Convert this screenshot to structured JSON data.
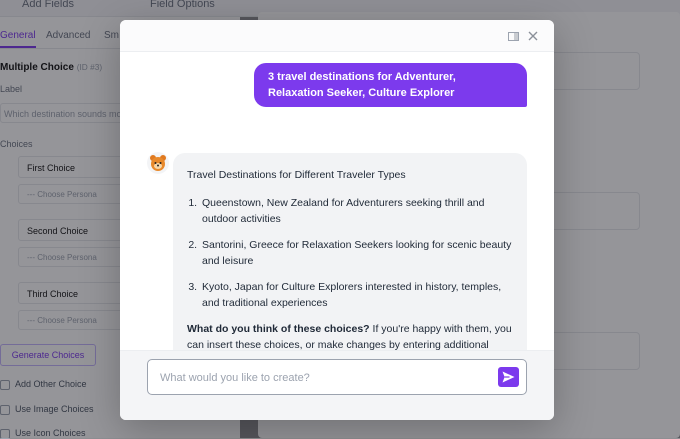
{
  "background": {
    "topbar": {
      "add_fields": "Add Fields",
      "field_options": "Field Options"
    },
    "tabs": [
      "General",
      "Advanced",
      "Sm"
    ],
    "field_title": "Multiple Choice",
    "field_id": "(ID #3)",
    "label_caption": "Label",
    "question_text": "Which destination sounds mo",
    "choices_caption": "Choices",
    "choices": [
      "First Choice",
      "Second Choice",
      "Third Choice"
    ],
    "persona_placeholder": "--- Choose Persona",
    "generate_button": "Generate Choices",
    "checkboxes": [
      "Add Other Choice",
      "Use Image Choices",
      "Use Icon Choices"
    ]
  },
  "modal": {
    "user_message": "3 travel destinations for Adventurer, Relaxation Seeker, Culture Explorer",
    "bot": {
      "heading": "Travel Destinations for Different Traveler Types",
      "items": [
        "Queenstown, New Zealand for Adventurers seeking thrill and outdoor activities",
        "Santorini, Greece for Relaxation Seekers looking for scenic beauty and leisure",
        "Kyoto, Japan for Culture Explorers interested in history, temples, and traditional experiences"
      ],
      "question_bold": "What do you think of these choices?",
      "question_rest": " If you're happy with them, you can insert these choices, or make changes by entering additional prompts."
    },
    "prompt": {
      "placeholder": "What would you like to create?",
      "value": ""
    }
  },
  "colors": {
    "accent": "#7c3aed",
    "bot_bubble": "#f2f3f5"
  },
  "icons": [
    "expand-icon",
    "close-icon",
    "bot-avatar-icon",
    "send-icon"
  ]
}
